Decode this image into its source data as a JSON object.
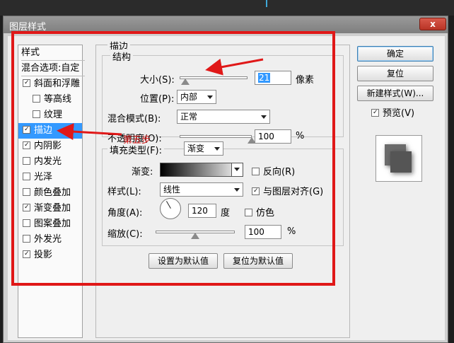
{
  "window": {
    "title": "图层样式",
    "close_glyph": "x"
  },
  "sidebar": {
    "header": "样式",
    "blend_options": "混合选项:自定",
    "items": [
      {
        "label": "斜面和浮雕",
        "checked": true,
        "indent": false
      },
      {
        "label": "等高线",
        "checked": false,
        "indent": true
      },
      {
        "label": "纹理",
        "checked": false,
        "indent": true
      },
      {
        "label": "描边",
        "checked": true,
        "indent": false,
        "selected": true
      },
      {
        "label": "内阴影",
        "checked": true,
        "indent": false
      },
      {
        "label": "内发光",
        "checked": false,
        "indent": false
      },
      {
        "label": "光泽",
        "checked": false,
        "indent": false
      },
      {
        "label": "颜色叠加",
        "checked": false,
        "indent": false
      },
      {
        "label": "渐变叠加",
        "checked": true,
        "indent": false
      },
      {
        "label": "图案叠加",
        "checked": false,
        "indent": false
      },
      {
        "label": "外发光",
        "checked": false,
        "indent": false
      },
      {
        "label": "投影",
        "checked": true,
        "indent": false
      }
    ]
  },
  "stroke": {
    "section_title": "描边",
    "structure_title": "结构",
    "size_label": "大小(S):",
    "size_value": "21",
    "size_unit": "像素",
    "size_fraction": 0.08,
    "position_label": "位置(P):",
    "position_value": "内部",
    "blend_label": "混合模式(B):",
    "blend_value": "正常",
    "opacity_label": "不透明度(O):",
    "opacity_value": "100",
    "opacity_unit": "%",
    "opacity_fraction": 1.0,
    "fill_type_label": "填充类型(F):",
    "fill_type_value": "渐变",
    "gradient_label": "渐变:",
    "reverse_label": "反向(R)",
    "reverse_checked": false,
    "style_label": "样式(L):",
    "style_value": "线性",
    "align_label": "与图层对齐(G)",
    "align_checked": true,
    "angle_label": "角度(A):",
    "angle_value": "120",
    "angle_unit": "度",
    "dither_label": "仿色",
    "dither_checked": false,
    "scale_label": "缩放(C):",
    "scale_value": "100",
    "scale_unit": "%",
    "scale_fraction": 0.5,
    "make_default": "设置为默认值",
    "reset_default": "复位为默认值"
  },
  "buttons": {
    "ok": "确定",
    "reset": "复位",
    "new_style": "新建样式(W)...",
    "preview_label": "预览(V)",
    "preview_checked": true
  },
  "annotation": {
    "step_label": "第五步",
    "color": "#e01818"
  }
}
